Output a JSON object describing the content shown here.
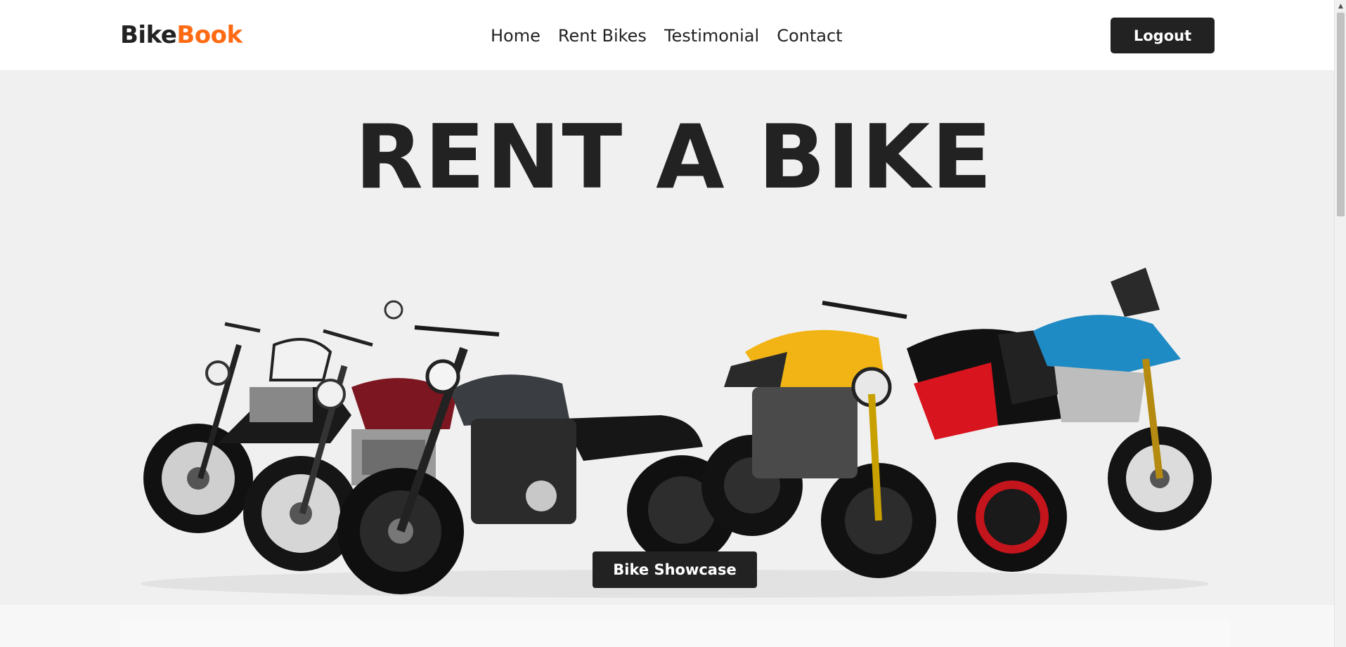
{
  "header": {
    "logo_part1": "Bike",
    "logo_part2": "Book",
    "nav": [
      "Home",
      "Rent Bikes",
      "Testimonial",
      "Contact"
    ],
    "logout_label": "Logout"
  },
  "hero": {
    "title": "RENT A BIKE",
    "bikes_image": "motorcycle-lineup-image",
    "showcase_label": "Bike Showcase"
  },
  "colors": {
    "accent": "#ff6a13",
    "dark": "#222222",
    "hero_bg": "#f0f0f0"
  }
}
